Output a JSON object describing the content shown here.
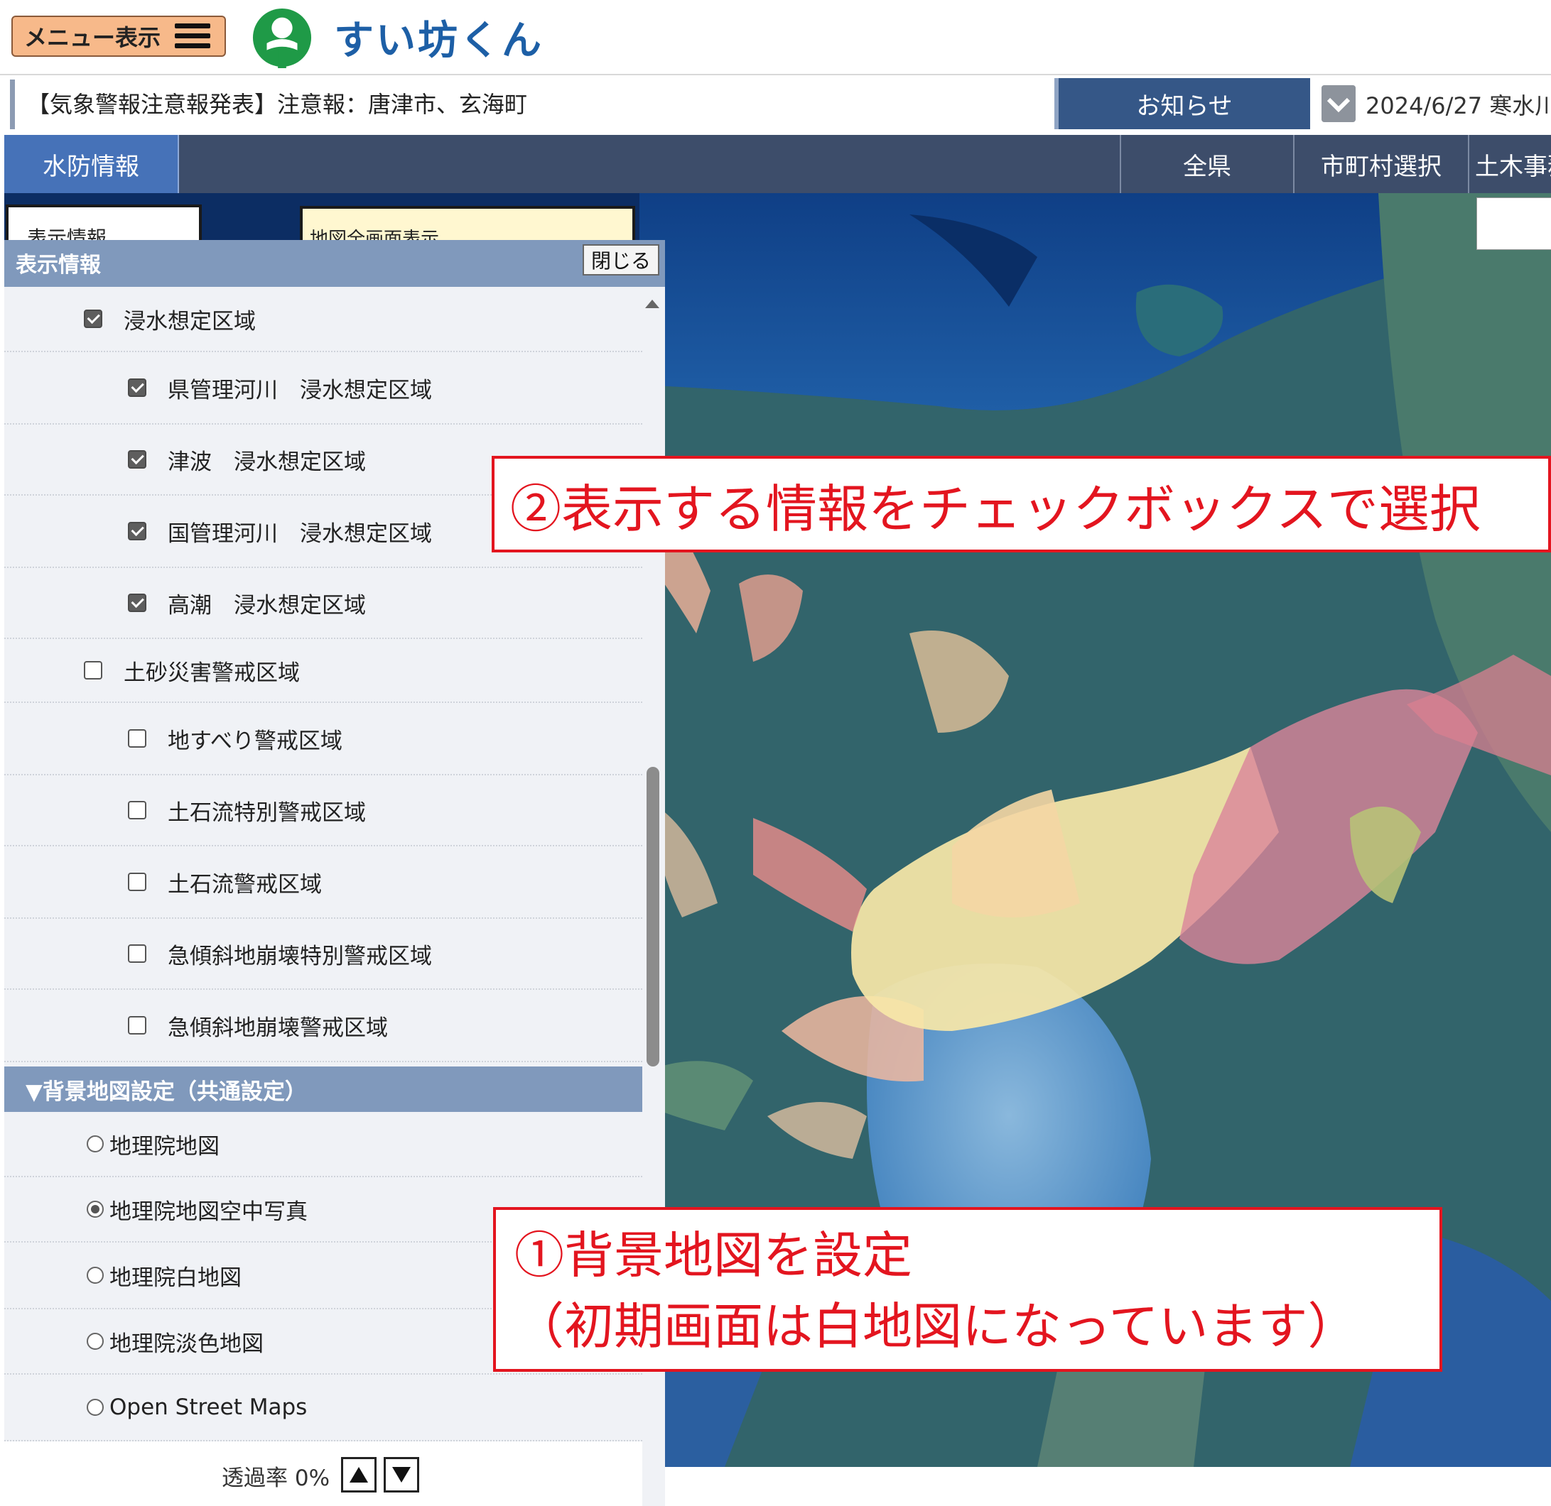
{
  "header": {
    "menu_label": "メニュー表示",
    "app_title": "すい坊くん"
  },
  "notice": {
    "alert": "【気象警報注意報発表】注意報：唐津市、玄海町",
    "oshirase": "お知らせ",
    "date": "2024/6/27 寒水川"
  },
  "nav": {
    "suibou": "水防情報",
    "all_pref": "全県",
    "municipality": "市町村選択",
    "doboku": "土木事務所"
  },
  "map_buttons": {
    "info": "表示情報",
    "fullscreen": "地図全画面表示"
  },
  "panel": {
    "title": "表示情報",
    "close": "閉じる",
    "layers": [
      {
        "label": "浸水想定区域",
        "checked": true,
        "level": 0
      },
      {
        "label": "県管理河川　浸水想定区域",
        "checked": true,
        "level": 1
      },
      {
        "label": "津波　浸水想定区域",
        "checked": true,
        "level": 1
      },
      {
        "label": "国管理河川　浸水想定区域",
        "checked": true,
        "level": 1
      },
      {
        "label": "高潮　浸水想定区域",
        "checked": true,
        "level": 1
      },
      {
        "label": "土砂災害警戒区域",
        "checked": false,
        "level": 0
      },
      {
        "label": "地すべり警戒区域",
        "checked": false,
        "level": 1
      },
      {
        "label": "土石流特別警戒区域",
        "checked": false,
        "level": 1
      },
      {
        "label": "土石流警戒区域",
        "checked": false,
        "level": 1
      },
      {
        "label": "急傾斜地崩壊特別警戒区域",
        "checked": false,
        "level": 1
      },
      {
        "label": "急傾斜地崩壊警戒区域",
        "checked": false,
        "level": 1
      }
    ],
    "bg_header": "▼背景地図設定（共通設定）",
    "bg_options": [
      {
        "label": "地理院地図",
        "selected": false
      },
      {
        "label": "地理院地図空中写真",
        "selected": true
      },
      {
        "label": "地理院白地図",
        "selected": false
      },
      {
        "label": "地理院淡色地図",
        "selected": false
      },
      {
        "label": "Open Street Maps",
        "selected": false
      }
    ],
    "opacity": "透過率 0%"
  },
  "callouts": {
    "step2": "②表示する情報をチェックボックスで選択",
    "step1_line1": "①背景地図を設定",
    "step1_line2": "（初期画面は白地図になっています）"
  },
  "colors": {
    "nav": "#3d4d6a",
    "nav_active": "#4672b8",
    "panel_header": "#8099bc",
    "callout_red": "#e3151f",
    "logo_green": "#1f9a47"
  }
}
